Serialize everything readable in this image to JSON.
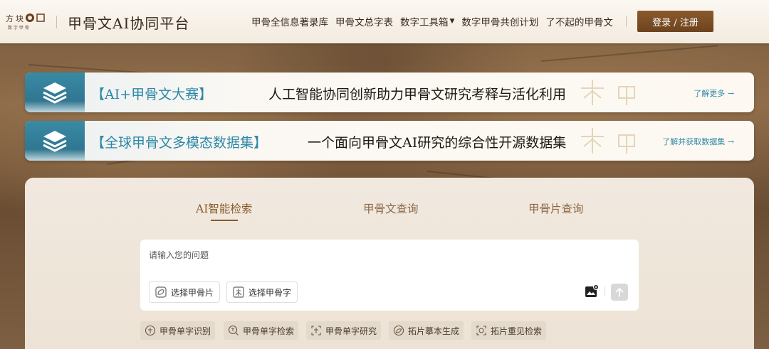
{
  "header": {
    "logo_alt": "方块数字图标",
    "title": "甲骨文AI协同平台",
    "nav": [
      {
        "label": "甲骨全信息著录库",
        "has_caret": false
      },
      {
        "label": "甲骨文总字表",
        "has_caret": false
      },
      {
        "label": "数字工具箱",
        "has_caret": true
      },
      {
        "label": "数字甲骨共创计划",
        "has_caret": false
      },
      {
        "label": "了不起的甲骨文",
        "has_caret": false
      }
    ],
    "login_label": "登录 / 注册"
  },
  "banners": [
    {
      "tag": "【AI+甲骨文大赛】",
      "text": "人工智能协同创新助力甲骨文研究考释与活化利用",
      "link": "了解更多 →"
    },
    {
      "tag": "【全球甲骨文多模态数据集】",
      "text": "一个面向甲骨文AI研究的综合性开源数据集",
      "link": "了解并获取数据集 →"
    }
  ],
  "search": {
    "tabs": [
      {
        "label": "AI智能检索",
        "active": true
      },
      {
        "label": "甲骨文查询",
        "active": false
      },
      {
        "label": "甲骨片查询",
        "active": false
      }
    ],
    "placeholder": "请输入您的问题",
    "chips": [
      {
        "label": "选择甲骨片",
        "icon": "bone-fragment-icon"
      },
      {
        "label": "选择甲骨字",
        "icon": "oracle-character-icon"
      }
    ]
  },
  "tools": [
    {
      "label": "甲骨单字识别",
      "icon": "recognize-icon"
    },
    {
      "label": "甲骨单字检索",
      "icon": "search-character-icon"
    },
    {
      "label": "甲骨单字研究",
      "icon": "research-icon"
    },
    {
      "label": "拓片摹本生成",
      "icon": "rubbing-generate-icon"
    },
    {
      "label": "拓片重见检索",
      "icon": "rubbing-search-icon"
    }
  ],
  "colors": {
    "brand_brown": "#8a5a2c",
    "accent_blue": "#2d87a6",
    "header_bg": "#f6efe6"
  }
}
